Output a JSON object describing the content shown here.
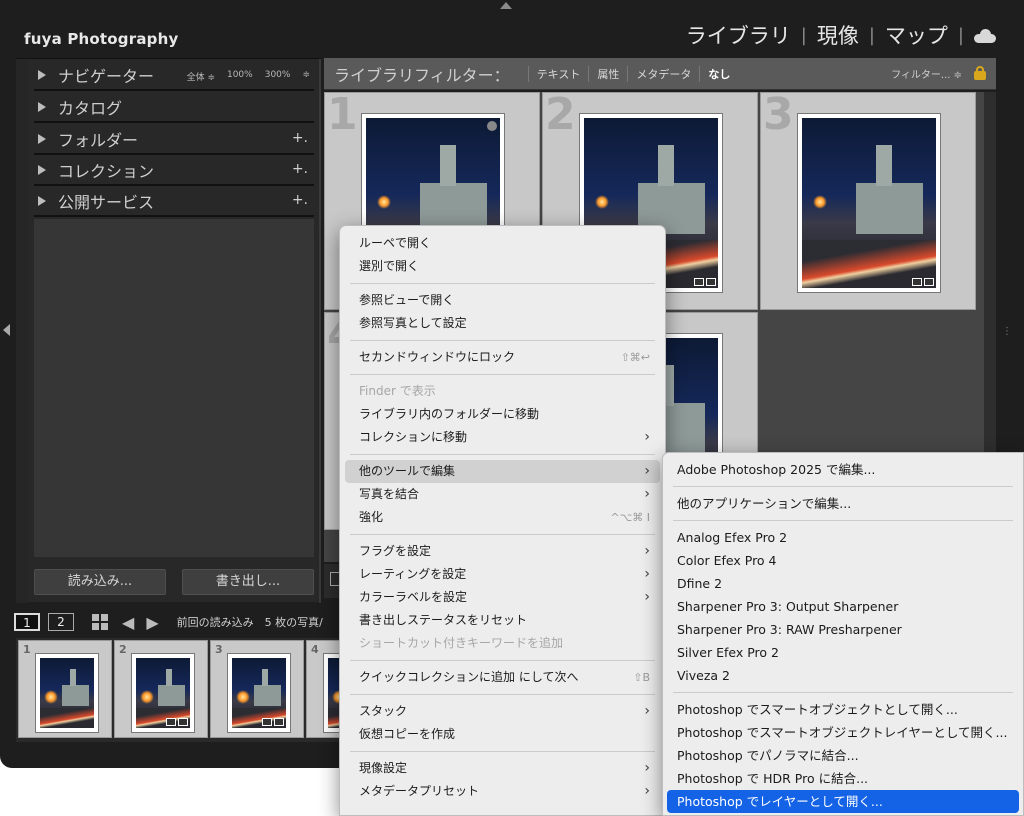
{
  "app": {
    "brand": "fuya Photography",
    "modules": [
      "ライブラリ",
      "現像",
      "マップ"
    ],
    "separator": "|"
  },
  "left_panel": {
    "sections": [
      {
        "label": "ナビゲーター",
        "zoom": [
          "全体 ≑",
          "100%",
          "300%",
          "≑"
        ]
      },
      {
        "label": "カタログ"
      },
      {
        "label": "フォルダー",
        "plus": "+."
      },
      {
        "label": "コレクション",
        "plus": "+."
      },
      {
        "label": "公開サービス",
        "plus": "+."
      }
    ],
    "import_button": "読み込み...",
    "export_button": "書き出し..."
  },
  "filter_bar": {
    "title": "ライブラリフィルター：",
    "items": [
      "テキスト",
      "属性",
      "メタデータ",
      "なし"
    ],
    "active": "なし",
    "preset": "フィルター... ≑"
  },
  "grid": {
    "cell_numbers": [
      "1",
      "2",
      "3",
      "4"
    ]
  },
  "filmstrip": {
    "views": [
      "1",
      "2"
    ],
    "source": "前回の読み込み　5 枚の写真/",
    "cells": [
      "1",
      "2",
      "3",
      "4"
    ]
  },
  "context_menu": {
    "groups": [
      [
        {
          "label": "ルーペで開く"
        },
        {
          "label": "選別で開く"
        }
      ],
      [
        {
          "label": "参照ビューで開く"
        },
        {
          "label": "参照写真として設定"
        }
      ],
      [
        {
          "label": "セカンドウィンドウにロック",
          "shortcut": "⇧⌘↩"
        }
      ],
      [
        {
          "label": "Finder で表示",
          "disabled": true
        },
        {
          "label": "ライブラリ内のフォルダーに移動"
        },
        {
          "label": "コレクションに移動",
          "submenu": true
        }
      ],
      [
        {
          "label": "他のツールで編集",
          "submenu": true,
          "highlight": true
        },
        {
          "label": "写真を結合",
          "submenu": true
        },
        {
          "label": "強化",
          "shortcut": "^⌥⌘ I"
        }
      ],
      [
        {
          "label": "フラグを設定",
          "submenu": true
        },
        {
          "label": "レーティングを設定",
          "submenu": true
        },
        {
          "label": "カラーラベルを設定",
          "submenu": true
        },
        {
          "label": "書き出しステータスをリセット"
        },
        {
          "label": "ショートカット付きキーワードを追加",
          "disabled": true
        }
      ],
      [
        {
          "label": "クイックコレクションに追加 にして次へ",
          "shortcut": "⇧B"
        }
      ],
      [
        {
          "label": "スタック",
          "submenu": true
        },
        {
          "label": "仮想コピーを作成"
        }
      ],
      [
        {
          "label": "現像設定",
          "submenu": true
        },
        {
          "label": "メタデータプリセット",
          "submenu": true
        }
      ]
    ]
  },
  "submenu": {
    "groups": [
      [
        "Adobe Photoshop 2025 で編集..."
      ],
      [
        "他のアプリケーションで編集..."
      ],
      [
        "Analog Efex Pro 2",
        "Color Efex Pro 4",
        "Dfine 2",
        "Sharpener Pro 3: Output Sharpener",
        "Sharpener Pro 3: RAW Presharpener",
        "Silver Efex Pro 2",
        "Viveza 2"
      ],
      [
        "Photoshop でスマートオブジェクトとして開く...",
        "Photoshop でスマートオブジェクトレイヤーとして開く...",
        "Photoshop でパノラマに結合...",
        "Photoshop で HDR Pro に結合...",
        "Photoshop でレイヤーとして開く..."
      ]
    ],
    "selected": "Photoshop でレイヤーとして開く..."
  },
  "colors": {
    "selection_blue": "#1463e6",
    "lock_yellow": "#d9a81c",
    "menu_bg": "#ededed"
  }
}
